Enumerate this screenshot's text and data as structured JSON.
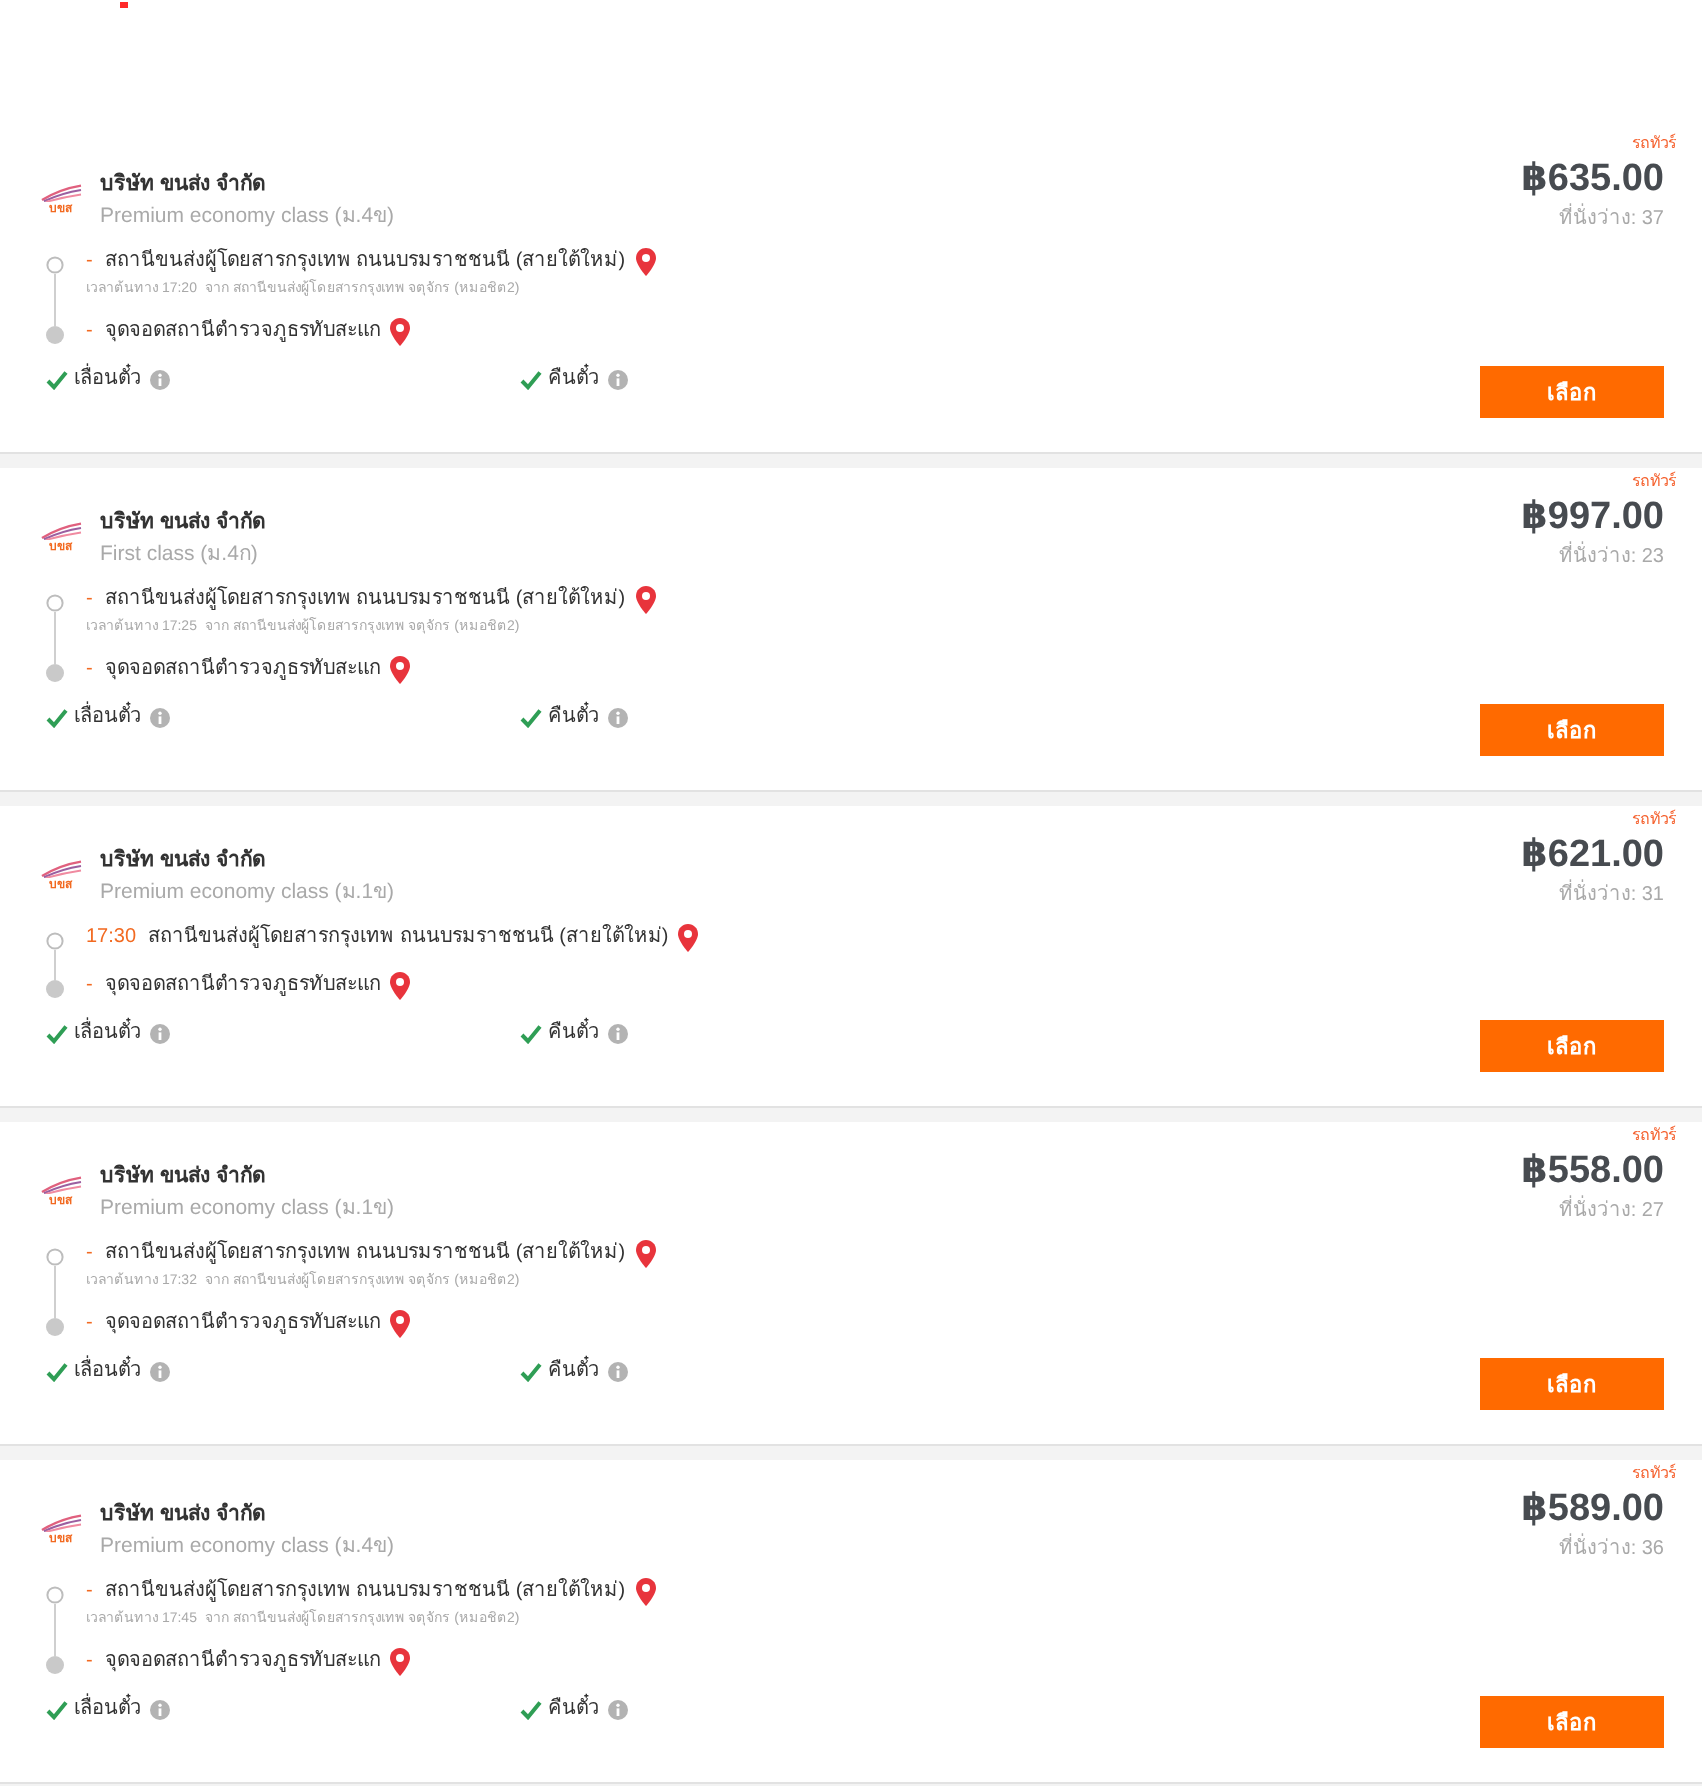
{
  "trips": [
    {
      "tag": "รถทัวร์",
      "logo_text": "บขส",
      "company": "บริษัท ขนส่ง จำกัด",
      "class": "Premium economy class (ม.4ข)",
      "price": "฿635.00",
      "seats": "ที่นั่งว่าง: 37",
      "stops": [
        {
          "kind": "origin",
          "lead": "-",
          "name": "สถานีขนส่งผู้โดยสารกรุงเทพ ถนนบรมราชชนนี (สายใต้ใหม่)",
          "note": "เวลาต้นทาง 17:20  จาก สถานีขนส่งผู้โดยสารกรุงเทพ จตุจักร (หมอชิต2)"
        },
        {
          "kind": "destination",
          "lead": "-",
          "name": "จุดจอดสถานีตำรวจภูธรทับสะแก"
        }
      ],
      "features": [
        {
          "label": "เลื่อนตั๋ว",
          "available": true
        },
        {
          "label": "คืนตั๋ว",
          "available": true
        }
      ],
      "button": "เลือก"
    },
    {
      "tag": "รถทัวร์",
      "logo_text": "บขส",
      "company": "บริษัท ขนส่ง จำกัด",
      "class": "First class (ม.4ก)",
      "price": "฿997.00",
      "seats": "ที่นั่งว่าง: 23",
      "stops": [
        {
          "kind": "origin",
          "lead": "-",
          "name": "สถานีขนส่งผู้โดยสารกรุงเทพ ถนนบรมราชชนนี (สายใต้ใหม่)",
          "note": "เวลาต้นทาง 17:25  จาก สถานีขนส่งผู้โดยสารกรุงเทพ จตุจักร (หมอชิต2)"
        },
        {
          "kind": "destination",
          "lead": "-",
          "name": "จุดจอดสถานีตำรวจภูธรทับสะแก"
        }
      ],
      "features": [
        {
          "label": "เลื่อนตั๋ว",
          "available": true
        },
        {
          "label": "คืนตั๋ว",
          "available": true
        }
      ],
      "button": "เลือก"
    },
    {
      "tag": "รถทัวร์",
      "logo_text": "บขส",
      "company": "บริษัท ขนส่ง จำกัด",
      "class": "Premium economy class (ม.1ข)",
      "price": "฿621.00",
      "seats": "ที่นั่งว่าง: 31",
      "stops": [
        {
          "kind": "origin",
          "lead": "17:30",
          "name": "สถานีขนส่งผู้โดยสารกรุงเทพ ถนนบรมราชชนนี (สายใต้ใหม่)"
        },
        {
          "kind": "destination",
          "lead": "-",
          "name": "จุดจอดสถานีตำรวจภูธรทับสะแก"
        }
      ],
      "features": [
        {
          "label": "เลื่อนตั๋ว",
          "available": true
        },
        {
          "label": "คืนตั๋ว",
          "available": true
        }
      ],
      "button": "เลือก"
    },
    {
      "tag": "รถทัวร์",
      "logo_text": "บขส",
      "company": "บริษัท ขนส่ง จำกัด",
      "class": "Premium economy class (ม.1ข)",
      "price": "฿558.00",
      "seats": "ที่นั่งว่าง: 27",
      "stops": [
        {
          "kind": "origin",
          "lead": "-",
          "name": "สถานีขนส่งผู้โดยสารกรุงเทพ ถนนบรมราชชนนี (สายใต้ใหม่)",
          "note": "เวลาต้นทาง 17:32  จาก สถานีขนส่งผู้โดยสารกรุงเทพ จตุจักร (หมอชิต2)"
        },
        {
          "kind": "destination",
          "lead": "-",
          "name": "จุดจอดสถานีตำรวจภูธรทับสะแก"
        }
      ],
      "features": [
        {
          "label": "เลื่อนตั๋ว",
          "available": true
        },
        {
          "label": "คืนตั๋ว",
          "available": true
        }
      ],
      "button": "เลือก"
    },
    {
      "tag": "รถทัวร์",
      "logo_text": "บขส",
      "company": "บริษัท ขนส่ง จำกัด",
      "class": "Premium economy class (ม.4ข)",
      "price": "฿589.00",
      "seats": "ที่นั่งว่าง: 36",
      "stops": [
        {
          "kind": "origin",
          "lead": "-",
          "name": "สถานีขนส่งผู้โดยสารกรุงเทพ ถนนบรมราชชนนี (สายใต้ใหม่)",
          "note": "เวลาต้นทาง 17:45  จาก สถานีขนส่งผู้โดยสารกรุงเทพ จตุจักร (หมอชิต2)"
        },
        {
          "kind": "destination",
          "lead": "-",
          "name": "จุดจอดสถานีตำรวจภูธรทับสะแก"
        }
      ],
      "features": [
        {
          "label": "เลื่อนตั๋ว",
          "available": true
        },
        {
          "label": "คืนตั๋ว",
          "available": true
        }
      ],
      "button": "เลือก"
    }
  ]
}
